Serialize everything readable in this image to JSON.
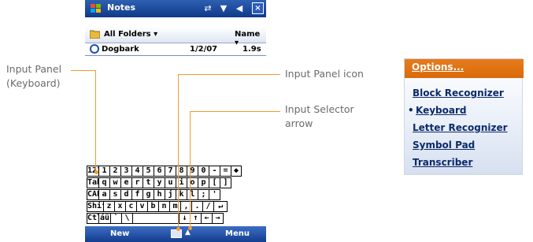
{
  "titlebar": {
    "app_title": "Notes",
    "close": "×"
  },
  "folderbar": {
    "folder": "All Folders ▾",
    "sort": "Name ▾"
  },
  "note": {
    "name": "Dogbark",
    "date": "1/2/07",
    "size": "1.9s"
  },
  "keyboard": {
    "rows": [
      [
        "123",
        "1",
        "2",
        "3",
        "4",
        "5",
        "6",
        "7",
        "8",
        "9",
        "0",
        "-",
        "=",
        "◆"
      ],
      [
        "Tab",
        "q",
        "w",
        "e",
        "r",
        "t",
        "y",
        "u",
        "i",
        "o",
        "p",
        "[",
        "]"
      ],
      [
        "CAP",
        "a",
        "s",
        "d",
        "f",
        "g",
        "h",
        "j",
        "k",
        "l",
        ";",
        "'"
      ],
      [
        "Shift",
        "z",
        "x",
        "c",
        "v",
        "b",
        "n",
        "m",
        ",",
        ".",
        "/",
        "↵"
      ],
      [
        "Ctl",
        "áü",
        "`",
        "\\",
        "",
        "↓",
        "↑",
        "←",
        "→"
      ]
    ]
  },
  "menubar": {
    "left": "New",
    "right": "Menu"
  },
  "callouts": {
    "input_panel_line1": "Input Panel",
    "input_panel_line2": "(Keyboard)",
    "input_panel_icon": "Input Panel icon",
    "selector_line1": "Input Selector",
    "selector_line2": "arrow"
  },
  "options": {
    "title": "Options...",
    "items": [
      "Block Recognizer",
      "Keyboard",
      "Letter Recognizer",
      "Symbol Pad",
      "Transcriber"
    ],
    "selected": "Keyboard"
  },
  "colors": {
    "accent": "#f39a2e",
    "titlebar": "#1f4fa8",
    "menu_header": "#e07214"
  }
}
